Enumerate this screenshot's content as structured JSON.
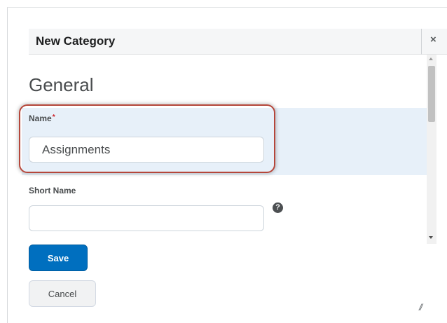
{
  "dialog": {
    "title": "New Category",
    "close_icon": "×",
    "close_icon_name": "close-icon"
  },
  "form": {
    "heading": "General",
    "name": {
      "label": "Name",
      "required_mark": "*",
      "value": "Assignments"
    },
    "short_name": {
      "label": "Short Name",
      "value": "",
      "help_icon": "?"
    }
  },
  "buttons": {
    "save_label": "Save",
    "cancel_label": "Cancel"
  },
  "colors": {
    "primary": "#006fbf",
    "name_section_bg": "#e7f0f9",
    "highlight_ring": "#b5463a",
    "required": "#cd2026"
  }
}
